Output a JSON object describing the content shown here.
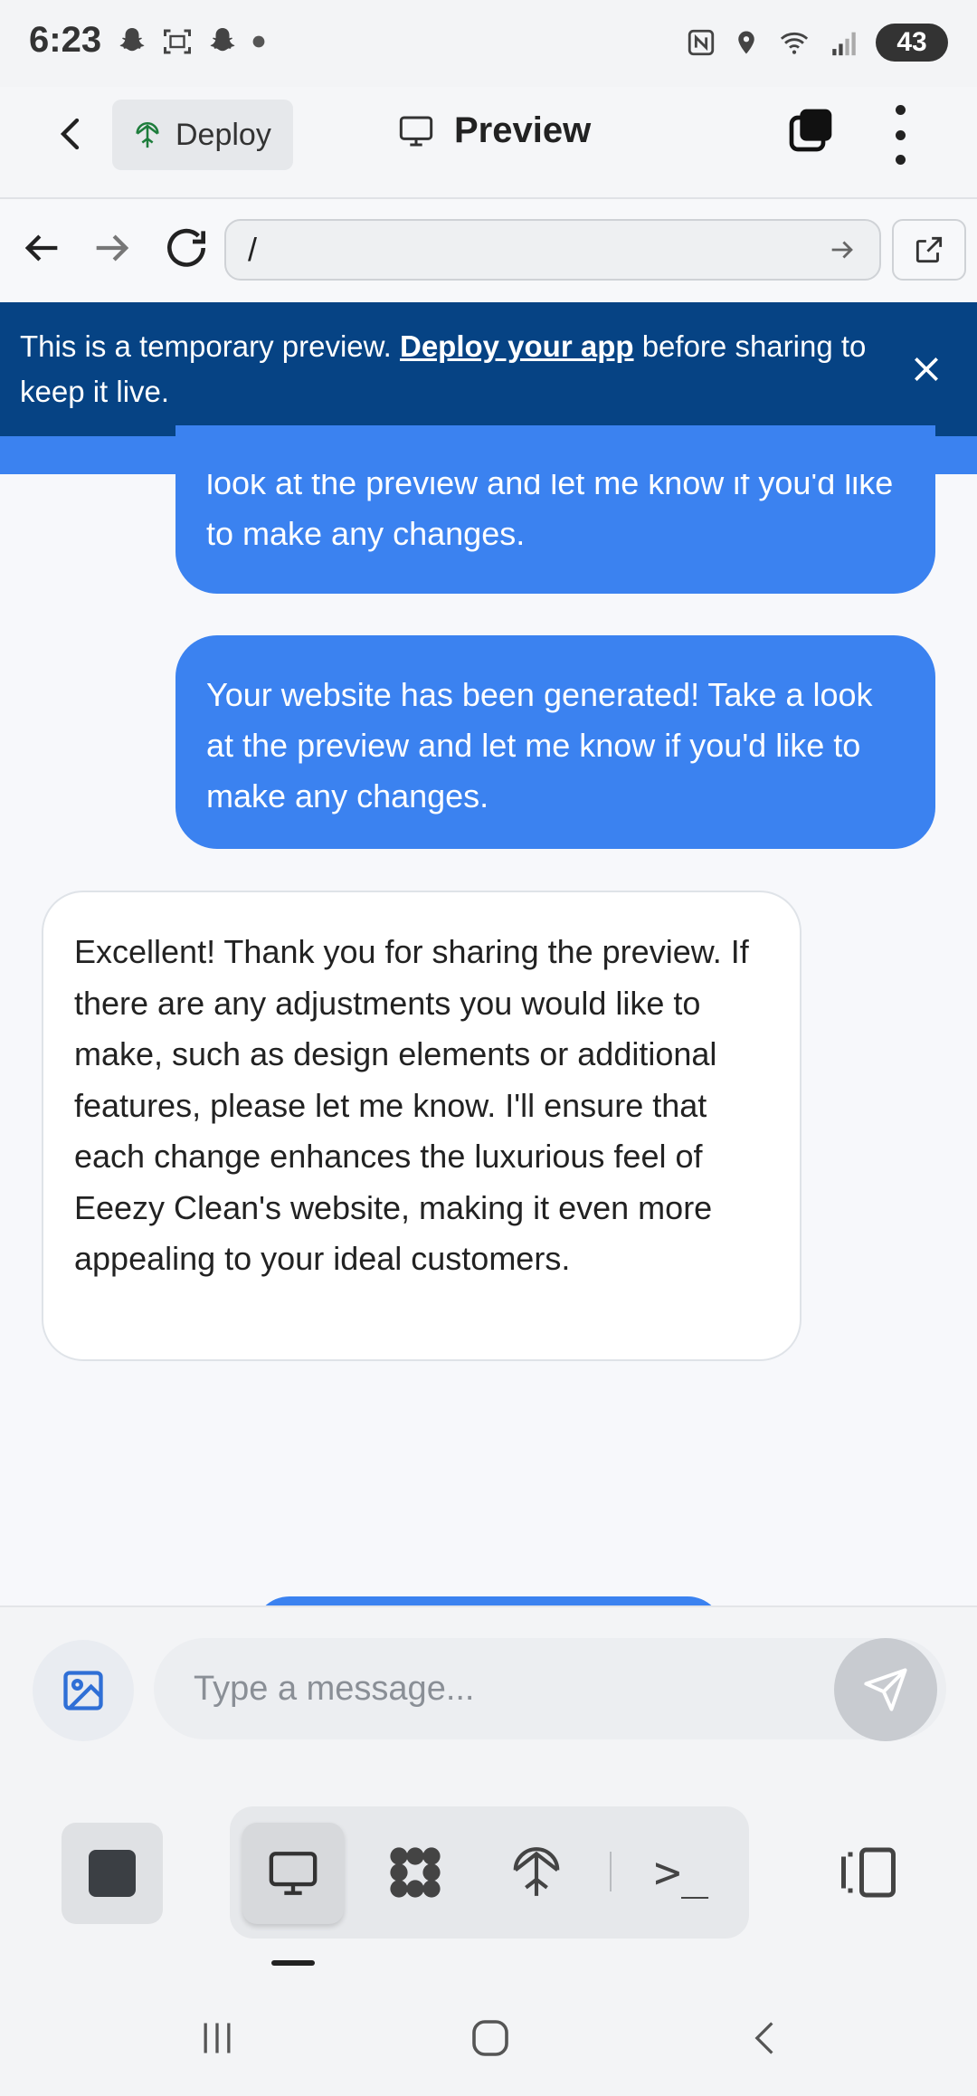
{
  "status_bar": {
    "time": "6:23",
    "battery": "43"
  },
  "header": {
    "deploy_label": "Deploy",
    "preview_label": "Preview"
  },
  "browser": {
    "url": "/"
  },
  "banner": {
    "text_before": "This is a temporary preview. ",
    "link_text": "Deploy your app",
    "text_after": " before sharing to keep it live."
  },
  "messages": [
    {
      "role": "user",
      "text": "look at the preview and let me know if you'd like to make any changes."
    },
    {
      "role": "user",
      "text": "Your website has been generated! Take a look at the preview and let me know if you'd like to make any changes."
    },
    {
      "role": "assistant",
      "text": "Excellent! Thank you for sharing the preview. If there are any adjustments you would like to make, such as design elements or additional features, please let me know. I'll ensure that each change enhances the luxurious feel of Eeezy Clean's website, making it even more appealing to your ideal customers."
    }
  ],
  "composer": {
    "placeholder": "Type a message..."
  },
  "toolbar": {
    "console_symbol": ">_"
  },
  "colors": {
    "accent": "#3b82f0",
    "banner": "#064384"
  }
}
